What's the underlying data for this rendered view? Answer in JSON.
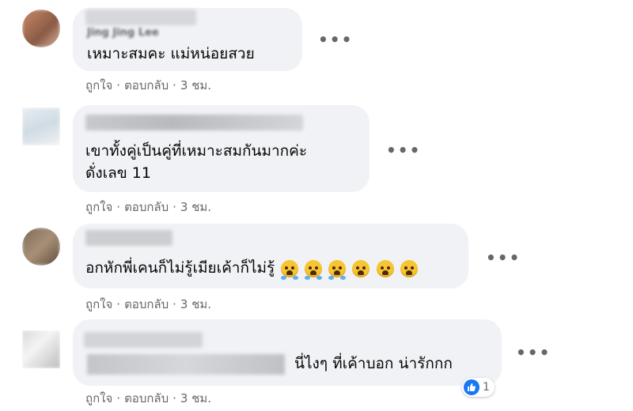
{
  "colors": {
    "bubble": "#f0f2f5",
    "text": "#050505",
    "secondary": "#65676b",
    "like_blue": "#1877f2"
  },
  "comments": [
    {
      "name_partial": "Jing Jing Lee",
      "text": "เหมาะสมคะ แม่หน่อยสวย",
      "actions": {
        "like": "ถูกใจ",
        "reply": "ตอบกลับ",
        "time": "3 ชม."
      }
    },
    {
      "text_line1": "เขาทั้งคู่เป็นคู่ที่เหมาะสมกันมากค่ะ",
      "text_line2": "ดั่งเลข 11",
      "actions": {
        "like": "ถูกใจ",
        "reply": "ตอบกลับ",
        "time": "3 ชม."
      }
    },
    {
      "text": "อกหักพี่เคนก็ไม่รู้เมียเค้าก็ไม่รู้",
      "emojis": [
        "loudly-crying-face",
        "loudly-crying-face",
        "loudly-crying-face",
        "crying-face",
        "crying-face",
        "crying-face"
      ],
      "actions": {
        "like": "ถูกใจ",
        "reply": "ตอบกลับ",
        "time": "3 ชม."
      }
    },
    {
      "text": "นี่ไงๆ ที่เค้าบอก น่ารักกก",
      "reaction_count": "1",
      "actions": {
        "like": "ถูกใจ",
        "reply": "ตอบกลับ",
        "time": "3 ชม."
      }
    }
  ],
  "more_label": "•••",
  "separator": "·"
}
